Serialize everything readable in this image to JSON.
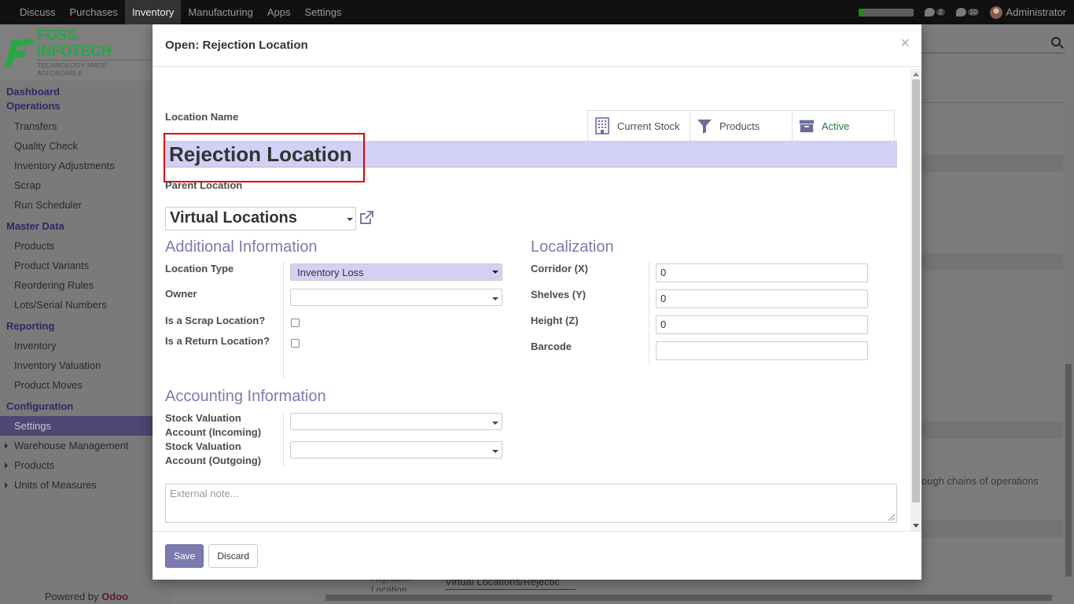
{
  "topbar": {
    "menu": [
      "Discuss",
      "Purchases",
      "Inventory",
      "Manufacturing",
      "Apps",
      "Settings"
    ],
    "active_index": 2,
    "progress_fraction": 0.08,
    "activity_count": "2",
    "messages_count": "10",
    "user_name": "Administrator"
  },
  "sidebar": {
    "logo": {
      "brand": "FOSS INFOTECH",
      "tagline": "TECHNOLOGY MADE AFFORDABLE"
    },
    "dashboard": "Dashboard",
    "operations": {
      "title": "Operations",
      "items": [
        "Transfers",
        "Quality Check",
        "Inventory Adjustments",
        "Scrap",
        "Run Scheduler"
      ]
    },
    "master_data": {
      "title": "Master Data",
      "items": [
        "Products",
        "Product Variants",
        "Reordering Rules",
        "Lots/Serial Numbers"
      ]
    },
    "reporting": {
      "title": "Reporting",
      "items": [
        "Inventory",
        "Inventory Valuation",
        "Product Moves"
      ]
    },
    "configuration": {
      "title": "Configuration",
      "settings": "Settings",
      "tree_items": [
        "Warehouse Management",
        "Products",
        "Units of Measures"
      ]
    },
    "powered_by": "Powered by",
    "powered_brand": "Odoo"
  },
  "background": {
    "hint_text": "ough chains of operations",
    "row_label_1": "Rejection",
    "row_label_2": "Location",
    "row_value": "Virtual Locations/Rejectic"
  },
  "modal": {
    "title": "Open: Rejection Location",
    "close": "×",
    "location_name_label": "Location Name",
    "location_name": "Rejection Location",
    "smart_buttons": {
      "current_stock": "Current Stock",
      "products": "Products",
      "active": "Active"
    },
    "parent_location_label": "Parent Location",
    "parent_location": "Virtual Locations",
    "additional_info": {
      "title": "Additional Information",
      "location_type_label": "Location Type",
      "location_type": "Inventory Loss",
      "owner_label": "Owner",
      "owner": "",
      "scrap_label": "Is a Scrap Location?",
      "scrap_checked": false,
      "return_label": "Is a Return Location?",
      "return_checked": false
    },
    "localization": {
      "title": "Localization",
      "corridor_label": "Corridor (X)",
      "corridor": "0",
      "shelves_label": "Shelves (Y)",
      "shelves": "0",
      "height_label": "Height (Z)",
      "height": "0",
      "barcode_label": "Barcode",
      "barcode": ""
    },
    "accounting": {
      "title": "Accounting Information",
      "incoming_label_1": "Stock Valuation",
      "incoming_label_2": "Account (Incoming)",
      "outgoing_label_1": "Stock Valuation",
      "outgoing_label_2": "Account (Outgoing)"
    },
    "note_placeholder": "External note...",
    "save_label": "Save",
    "discard_label": "Discard"
  }
}
